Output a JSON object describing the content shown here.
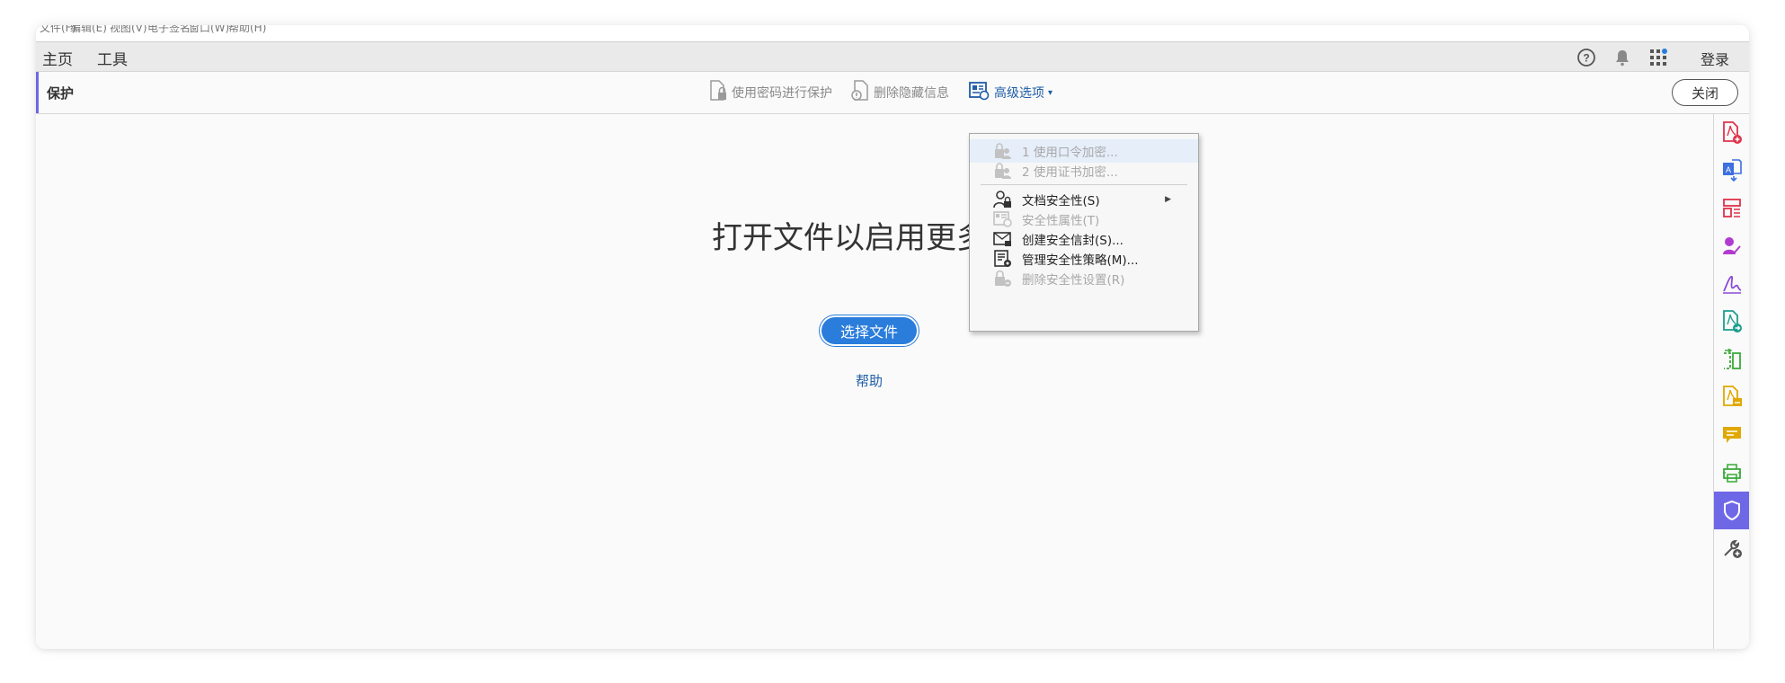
{
  "menubar": {
    "items": [
      "文件(F)",
      "编辑(E)",
      "视图(V)",
      "电子签名",
      "窗口(W)",
      "帮助(H)"
    ]
  },
  "tabs": [
    {
      "label": "主页",
      "active": false
    },
    {
      "label": "工具",
      "active": true
    }
  ],
  "header": {
    "help_icon": "help-circle-icon",
    "bell_icon": "bell-icon",
    "apps_icon": "apps-grid-icon",
    "login_label": "登录"
  },
  "toolbar": {
    "title": "保护",
    "buttons": [
      {
        "label": "使用密码进行保护",
        "icon": "lock-document-icon",
        "active": false
      },
      {
        "label": "删除隐藏信息",
        "icon": "remove-hidden-info-icon",
        "active": false
      },
      {
        "label": "高级选项",
        "icon": "advanced-options-icon",
        "active": true
      }
    ],
    "dropdown_caret": "▾",
    "close_label": "关闭"
  },
  "main": {
    "message": "打开文件以启用更多",
    "select_file_label": "选择文件",
    "help_label": "帮助"
  },
  "dropdown": {
    "items": [
      {
        "label": "1 使用口令加密...",
        "disabled": true,
        "icon": "user-lock-icon"
      },
      {
        "label": "2 使用证书加密...",
        "disabled": true,
        "icon": "user-lock-icon"
      },
      {
        "label": "文档安全性(S)",
        "disabled": false,
        "icon": "user-lock-icon",
        "submenu": true
      },
      {
        "label": "安全性属性(T)",
        "disabled": true,
        "icon": "security-properties-icon"
      },
      {
        "label": "创建安全信封(S)...",
        "disabled": false,
        "icon": "secure-envelope-icon"
      },
      {
        "label": "管理安全性策略(M)...",
        "disabled": false,
        "icon": "policy-manager-icon"
      },
      {
        "label": "删除安全性设置(R)",
        "disabled": true,
        "icon": "remove-security-icon"
      }
    ]
  },
  "right_rail": {
    "icons": [
      {
        "name": "create-pdf-icon",
        "color": "#e0334a"
      },
      {
        "name": "export-pdf-icon",
        "color": "#3d6fe0"
      },
      {
        "name": "organize-pages-icon",
        "color": "#e0334a"
      },
      {
        "name": "request-signatures-icon",
        "color": "#b13bd0"
      },
      {
        "name": "fill-sign-icon",
        "color": "#8a4bd8"
      },
      {
        "name": "export-share-icon",
        "color": "#1c9e8e"
      },
      {
        "name": "compare-files-icon",
        "color": "#3bab3b"
      },
      {
        "name": "edit-pdf-icon",
        "color": "#e0a800"
      },
      {
        "name": "comment-icon",
        "color": "#e0a800"
      },
      {
        "name": "print-production-icon",
        "color": "#3bab3b"
      },
      {
        "name": "protect-shield-icon",
        "color": "#6f68e6",
        "active": true
      },
      {
        "name": "more-tools-icon",
        "color": "#555555"
      }
    ]
  }
}
